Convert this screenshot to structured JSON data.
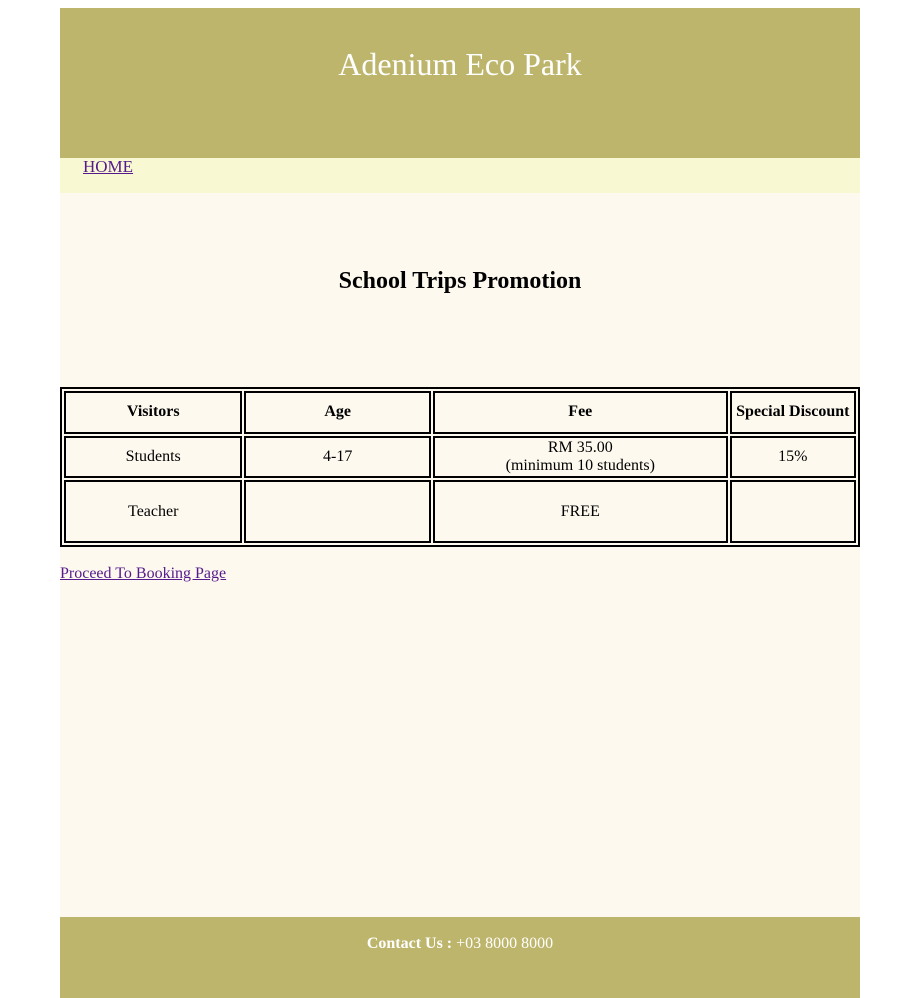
{
  "header": {
    "title": "Adenium Eco Park"
  },
  "nav": {
    "home_label": "HOME"
  },
  "main": {
    "heading": "School Trips Promotion",
    "table": {
      "columns": [
        "Visitors",
        "Age",
        "Fee",
        "Special Discount"
      ],
      "rows": [
        {
          "visitors": "Students",
          "age": "4-17",
          "fee": "RM 35.00",
          "fee_note": "(minimum 10 students)",
          "discount": "15%"
        },
        {
          "visitors": "Teacher",
          "age": "",
          "fee": "FREE",
          "fee_note": "",
          "discount": ""
        }
      ]
    },
    "booking_link": "Proceed To Booking Page"
  },
  "footer": {
    "contact_label": "Contact Us :",
    "phone": "+03 8000 8000"
  }
}
